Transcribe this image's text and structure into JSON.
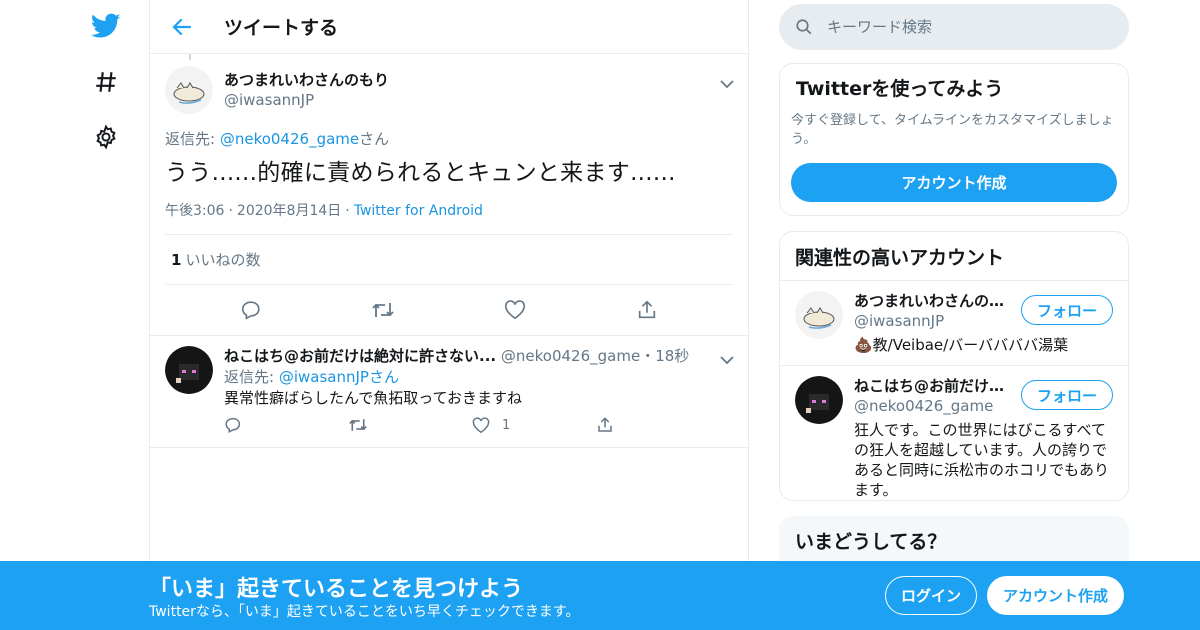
{
  "header": {
    "title": "ツイートする"
  },
  "search": {
    "placeholder": "キーワード検索"
  },
  "tweet": {
    "display_name": "あつまれいわさんのもり",
    "handle": "@iwasannJP",
    "reply_to_prefix": "返信先: ",
    "reply_to_handle": "@neko0426_game",
    "reply_to_suffix": "さん",
    "text": "うう......的確に責められるとキュンと来ます......",
    "time": "午後3:06",
    "date": "2020年8月14日",
    "source": "Twitter for Android",
    "likes_count": "1",
    "likes_label": "いいねの数"
  },
  "reply": {
    "display_name": "ねこはち@お前だけは絶対に許さない...",
    "handle": "@neko0426_game",
    "time_sep": "・",
    "time": "18秒",
    "reply_to_prefix": "返信先: ",
    "reply_to_handle": "@iwasannJPさん",
    "text": "異常性癖ばらしたんで魚拓取っておきますね",
    "like_count": "1"
  },
  "signup_card": {
    "title": "Twitterを使ってみよう",
    "desc": "今すぐ登録して、タイムラインをカスタマイズしましょう。",
    "button": "アカウント作成"
  },
  "related": {
    "title": "関連性の高いアカウント",
    "accounts": [
      {
        "name": "あつまれいわさんのもり",
        "handle": "@iwasannJP",
        "bio": "💩教/Veibae/バーババババ湯葉",
        "follow": "フォロー"
      },
      {
        "name": "ねこはち@お前だけは絶対に許さない",
        "handle": "@neko0426_game",
        "bio": "狂人です。この世界にはびこるすべての狂人を超越しています。人の誇りであると同時に浜松市のホコリでもあります。",
        "follow": "フォロー"
      }
    ]
  },
  "whats_happening": {
    "title": "いまどうしてる？"
  },
  "banner": {
    "title": "「いま」起きていることを見つけよう",
    "subtitle": "Twitterなら、「いま」起きていることをいち早くチェックできます。",
    "login": "ログイン",
    "signup": "アカウント作成"
  },
  "colors": {
    "accent": "#1da1f2",
    "link": "#1b95e0",
    "muted": "#657786",
    "border": "#e6ecf0"
  }
}
